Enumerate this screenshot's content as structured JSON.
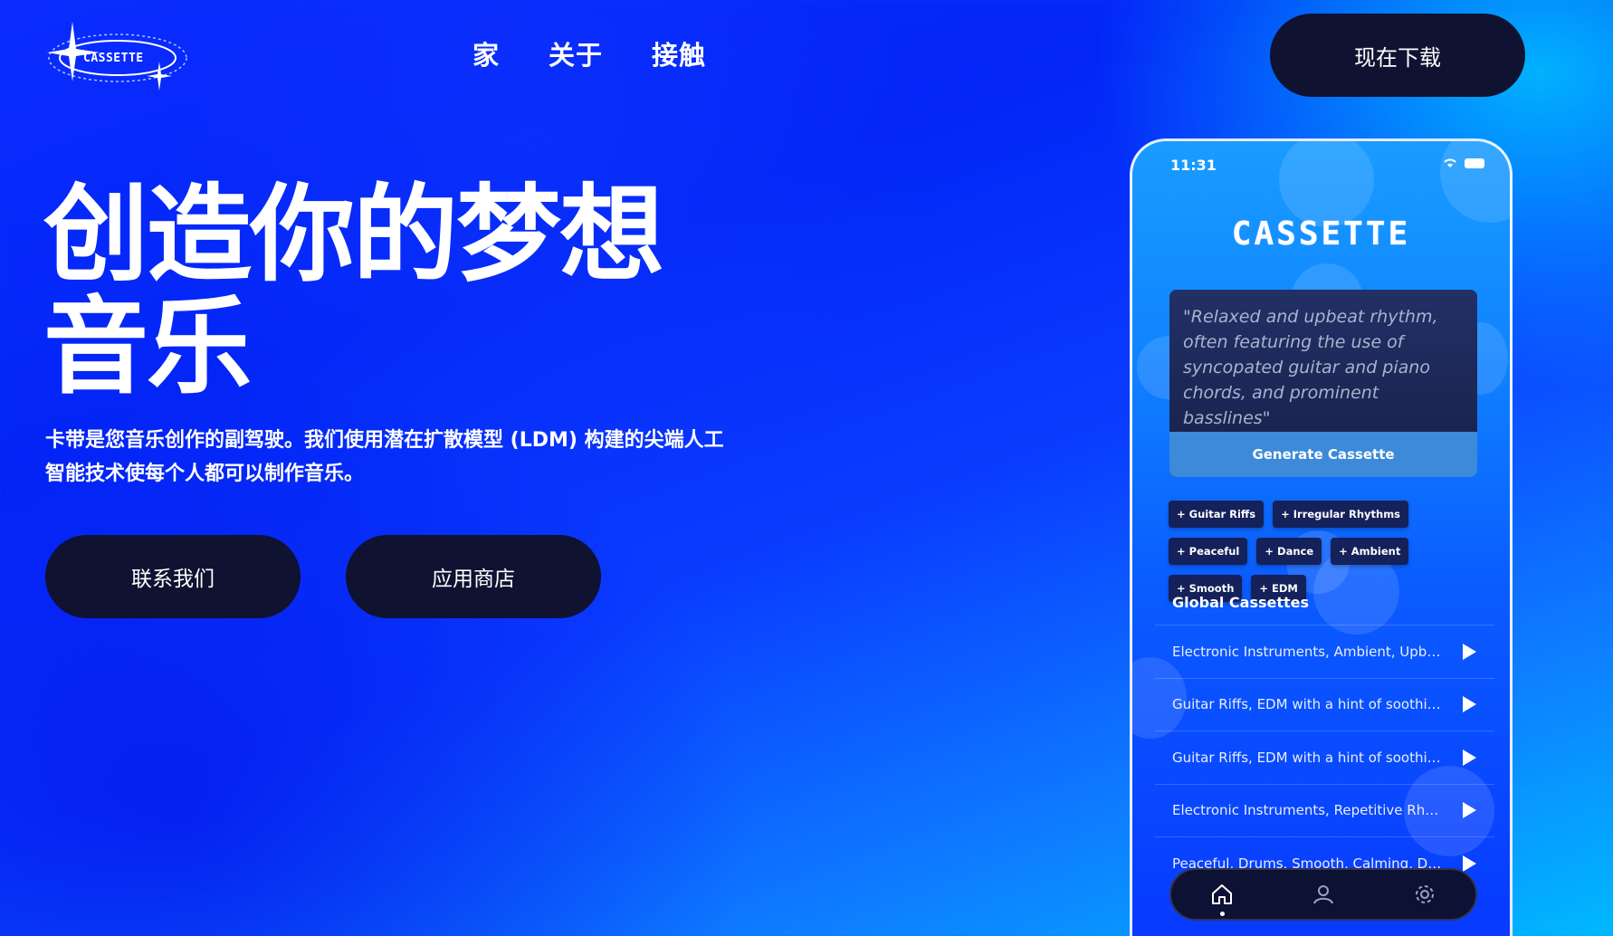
{
  "header": {
    "logo_text": "CASSETTE",
    "nav": [
      "家",
      "关于",
      "接触"
    ],
    "download_label": "现在下载"
  },
  "hero": {
    "title": "创造你的梦想音乐",
    "description": "卡带是您音乐创作的副驾驶。我们使用潜在扩散模型 (LDM) 构建的尖端人工智能技术使每个人都可以制作音乐。",
    "buttons": [
      "联系我们",
      "应用商店"
    ]
  },
  "phone": {
    "status_time": "11:31",
    "app_title": "CASSETTE",
    "prompt": "\"Relaxed and upbeat rhythm, often featuring the use of syncopated guitar and piano chords, and prominent basslines\"",
    "generate_label": "Generate Cassette",
    "tags": [
      "+ Guitar Riffs",
      "+ Irregular Rhythms",
      "+ Peaceful",
      "+ Dance",
      "+ Ambient",
      "+ Smooth",
      "+ EDM"
    ],
    "section_title": "Global Cassettes",
    "cassettes": [
      "Electronic Instruments, Ambient, Upbeat, Dance",
      "Guitar Riffs, EDM with a hint of soothing beats",
      "Guitar Riffs, EDM with a hint of soothing beats",
      "Electronic Instruments, Repetitive Rhythms",
      "Peaceful, Drums, Smooth, Calming, Dance"
    ],
    "tabs": [
      "home-icon",
      "profile-icon",
      "settings-icon"
    ]
  }
}
